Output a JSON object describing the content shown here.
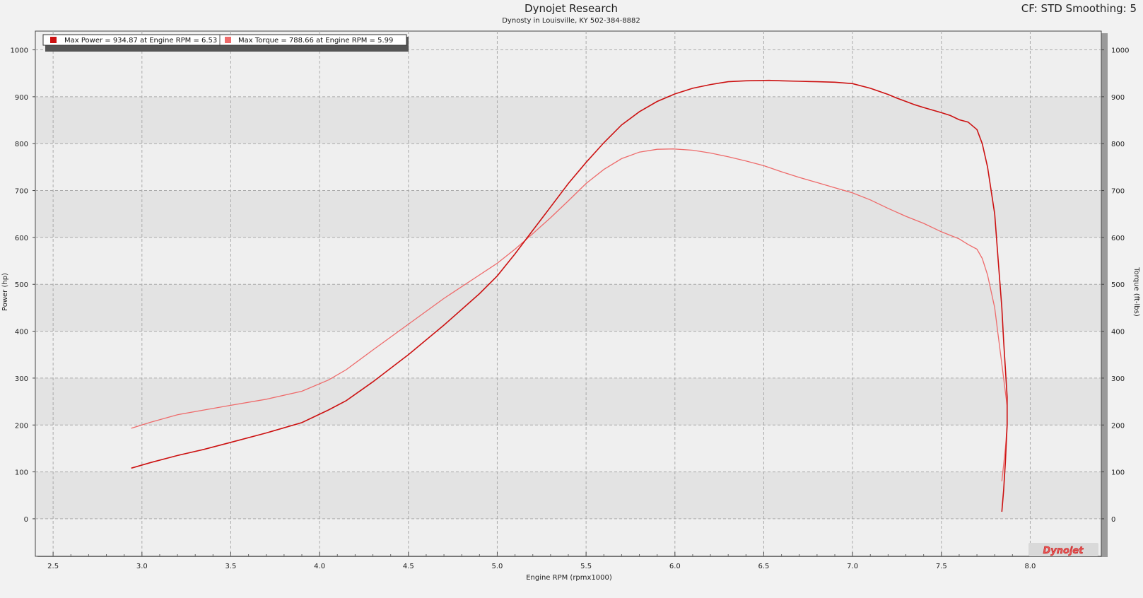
{
  "header": {
    "title": "Dynojet Research",
    "subtitle": "Dynosty in Louisville, KY 502-384-8882",
    "settings": "CF: STD Smoothing: 5"
  },
  "logo": {
    "text": "Dynojet"
  },
  "colors": {
    "power": "#cc1111",
    "torque": "#ee6b6b",
    "plot_band_light": "#efefef",
    "plot_band_dark": "#e3e3e3"
  },
  "chart_data": {
    "type": "line",
    "xlabel": "Engine RPM (rpmx1000)",
    "ylabel_left": "Power (hp)",
    "ylabel_right": "Torque (ft-lbs)",
    "xlim": [
      2.4,
      8.4
    ],
    "ylim": [
      -80,
      1040
    ],
    "x_ticks": [
      "2.5",
      "3.0",
      "3.5",
      "4.0",
      "4.5",
      "5.0",
      "5.5",
      "6.0",
      "6.5",
      "7.0",
      "7.5",
      "8.0"
    ],
    "y_ticks": [
      "0",
      "100",
      "200",
      "300",
      "400",
      "500",
      "600",
      "700",
      "800",
      "900",
      "1000"
    ],
    "grid": true,
    "legend_position": "top-left",
    "legend": [
      "Max Power = 934.87 at Engine RPM = 6.53",
      "Max Torque = 788.66 at Engine RPM = 5.99"
    ],
    "series": [
      {
        "name": "Power",
        "x": [
          2.94,
          3.05,
          3.2,
          3.35,
          3.5,
          3.7,
          3.9,
          4.05,
          4.15,
          4.3,
          4.5,
          4.7,
          4.9,
          5.0,
          5.1,
          5.2,
          5.3,
          5.4,
          5.5,
          5.6,
          5.7,
          5.8,
          5.9,
          6.0,
          6.1,
          6.2,
          6.3,
          6.4,
          6.53,
          6.6,
          6.7,
          6.8,
          6.9,
          7.0,
          7.1,
          7.2,
          7.25,
          7.3,
          7.35,
          7.4,
          7.5,
          7.55,
          7.6,
          7.65,
          7.7,
          7.73,
          7.76,
          7.8,
          7.82,
          7.84,
          7.85,
          7.86,
          7.87,
          7.87,
          7.86,
          7.85,
          7.84
        ],
        "values": [
          108,
          120,
          135,
          148,
          163,
          183,
          205,
          232,
          252,
          292,
          350,
          413,
          480,
          518,
          565,
          615,
          665,
          715,
          760,
          802,
          840,
          868,
          890,
          906,
          918,
          926,
          932,
          934,
          934.87,
          934,
          933,
          932,
          931,
          928,
          918,
          905,
          897,
          890,
          883,
          877,
          866,
          860,
          851,
          846,
          830,
          800,
          750,
          650,
          550,
          450,
          380,
          320,
          260,
          200,
          120,
          60,
          15
        ]
      },
      {
        "name": "Torque",
        "x": [
          2.94,
          3.05,
          3.2,
          3.35,
          3.5,
          3.7,
          3.9,
          4.05,
          4.15,
          4.3,
          4.5,
          4.7,
          4.9,
          5.0,
          5.1,
          5.2,
          5.3,
          5.4,
          5.5,
          5.6,
          5.7,
          5.8,
          5.9,
          5.99,
          6.1,
          6.2,
          6.3,
          6.4,
          6.5,
          6.6,
          6.7,
          6.8,
          6.9,
          7.0,
          7.1,
          7.2,
          7.3,
          7.4,
          7.5,
          7.6,
          7.65,
          7.7,
          7.73,
          7.76,
          7.8,
          7.82,
          7.84,
          7.85,
          7.86,
          7.87,
          7.87,
          7.86,
          7.84
        ],
        "values": [
          193,
          206,
          222,
          232,
          242,
          255,
          272,
          296,
          318,
          360,
          415,
          470,
          520,
          545,
          575,
          608,
          642,
          678,
          715,
          745,
          768,
          782,
          788,
          788.66,
          786,
          780,
          772,
          763,
          753,
          740,
          728,
          717,
          706,
          695,
          680,
          662,
          645,
          630,
          612,
          597,
          585,
          575,
          555,
          520,
          450,
          390,
          330,
          300,
          270,
          240,
          200,
          150,
          80
        ]
      }
    ]
  }
}
